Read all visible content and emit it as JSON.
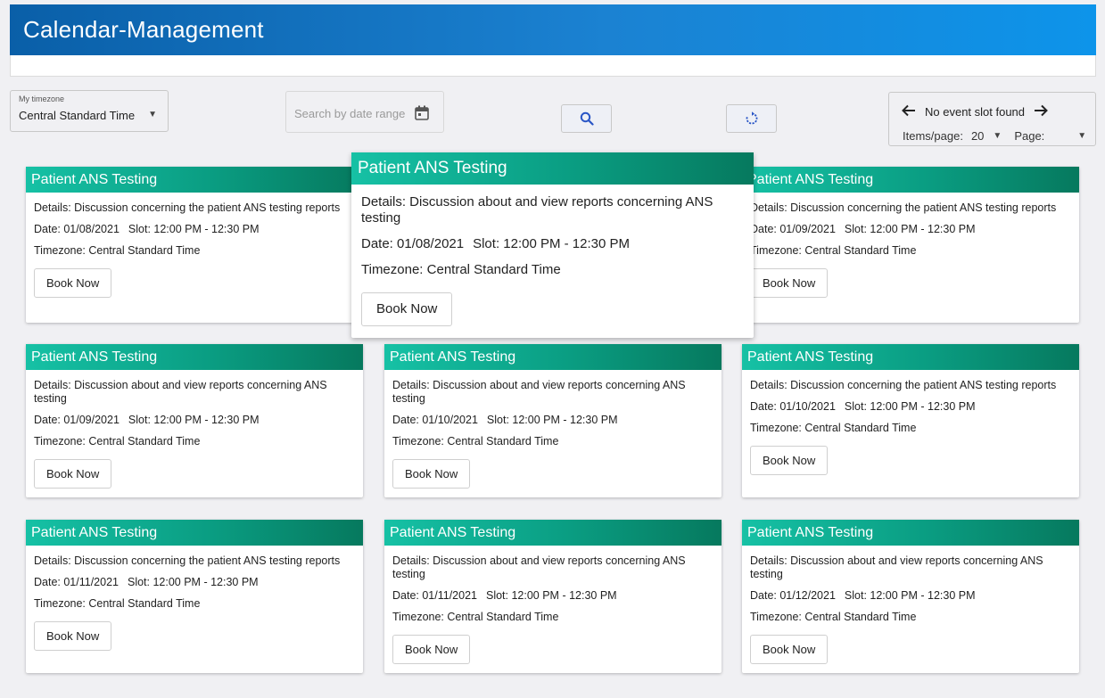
{
  "app": {
    "title": "Calendar-Management"
  },
  "filters": {
    "timezone_label": "My timezone",
    "timezone_value": "Central Standard Time",
    "date_placeholder": "Search by date range"
  },
  "pager": {
    "status": "No event slot found",
    "items_label": "Items/page:",
    "items_value": "20",
    "page_label": "Page:"
  },
  "icons": {
    "dropdown": "chevron-down-icon",
    "calendar": "calendar-icon",
    "search": "search-icon",
    "refresh": "refresh-icon",
    "prev": "arrow-left-icon",
    "next": "arrow-right-icon"
  },
  "colors": {
    "header_start": "#0a5fa8",
    "header_end": "#0d94ea",
    "card_title_start": "#16c1a5",
    "card_title_end": "#06795e"
  },
  "cards": [
    {
      "title": "Patient ANS Testing",
      "details": "Details: Discussion concerning the patient ANS testing reports",
      "date": "Date: 01/08/2021",
      "slot": "Slot: 12:00 PM - 12:30 PM",
      "timezone": "Timezone: Central Standard Time",
      "button": "Book Now"
    },
    {
      "title": "Patient ANS Testing",
      "details": "Details: Discussion about and view reports concerning ANS testing",
      "date": "Date: 01/08/2021",
      "slot": "Slot: 12:00 PM - 12:30 PM",
      "timezone": "Timezone: Central Standard Time",
      "button": "Book Now"
    },
    {
      "title": "Patient ANS Testing",
      "details": "Details: Discussion concerning the patient ANS testing reports",
      "date": "Date: 01/09/2021",
      "slot": "Slot: 12:00 PM - 12:30 PM",
      "timezone": "Timezone: Central Standard Time",
      "button": "Book Now"
    },
    {
      "title": "Patient ANS Testing",
      "details": "Details: Discussion about and view reports concerning ANS testing",
      "date": "Date: 01/09/2021",
      "slot": "Slot: 12:00 PM - 12:30 PM",
      "timezone": "Timezone: Central Standard Time",
      "button": "Book Now"
    },
    {
      "title": "Patient ANS Testing",
      "details": "Details: Discussion about and view reports concerning ANS testing",
      "date": "Date: 01/10/2021",
      "slot": "Slot: 12:00 PM - 12:30 PM",
      "timezone": "Timezone: Central Standard Time",
      "button": "Book Now"
    },
    {
      "title": "Patient ANS Testing",
      "details": "Details: Discussion concerning the patient ANS testing reports",
      "date": "Date: 01/10/2021",
      "slot": "Slot: 12:00 PM - 12:30 PM",
      "timezone": "Timezone: Central Standard Time",
      "button": "Book Now"
    },
    {
      "title": "Patient ANS Testing",
      "details": "Details: Discussion concerning the patient ANS testing reports",
      "date": "Date: 01/11/2021",
      "slot": "Slot: 12:00 PM - 12:30 PM",
      "timezone": "Timezone: Central Standard Time",
      "button": "Book Now"
    },
    {
      "title": "Patient ANS Testing",
      "details": "Details: Discussion about and view reports concerning ANS testing",
      "date": "Date: 01/11/2021",
      "slot": "Slot: 12:00 PM - 12:30 PM",
      "timezone": "Timezone: Central Standard Time",
      "button": "Book Now"
    },
    {
      "title": "Patient ANS Testing",
      "details": "Details: Discussion about and view reports concerning ANS testing",
      "date": "Date: 01/12/2021",
      "slot": "Slot: 12:00 PM - 12:30 PM",
      "timezone": "Timezone: Central Standard Time",
      "button": "Book Now"
    }
  ]
}
